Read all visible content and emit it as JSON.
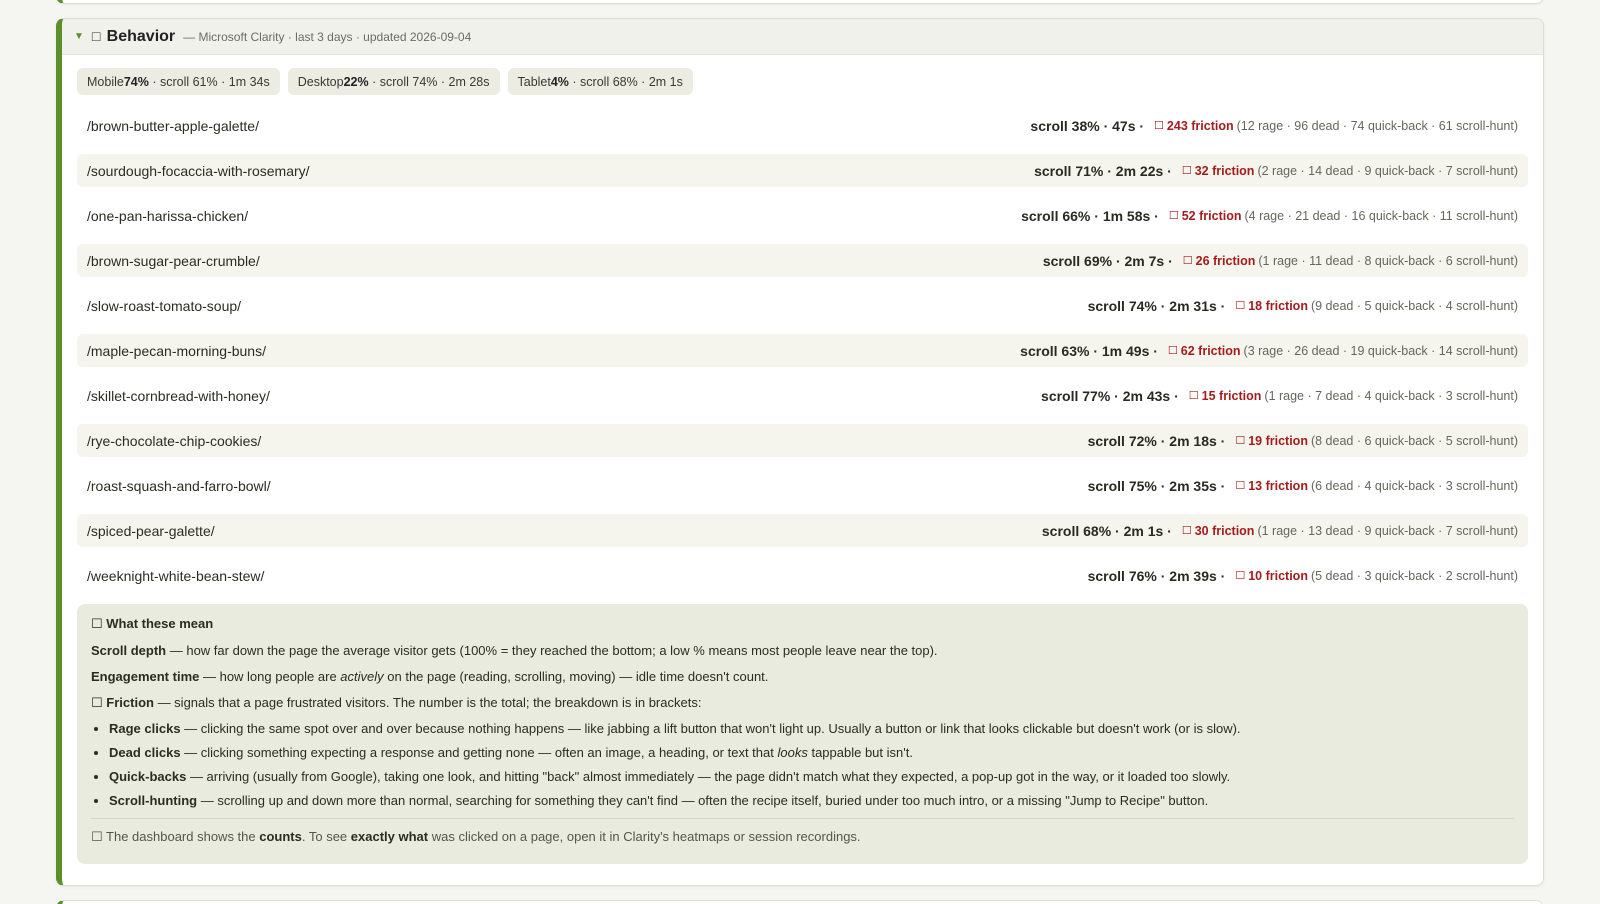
{
  "section": {
    "title": "Behavior",
    "subtitle": "— Microsoft Clarity · last 3 days · updated 2026-09-04",
    "caret_icon": "chevron-down-icon",
    "title_icon": "pointer-icon"
  },
  "devices": [
    {
      "name": "Mobile",
      "share": "74%",
      "details": " · scroll 61% · 1m 34s"
    },
    {
      "name": "Desktop",
      "share": "22%",
      "details": " · scroll 74% · 2m 28s"
    },
    {
      "name": "Tablet",
      "share": "4%",
      "details": " · scroll 68% · 2m 1s"
    }
  ],
  "pages": [
    {
      "path": "/brown-butter-apple-galette/",
      "summary": "scroll 38% · 47s ·",
      "friction": "243 friction",
      "breakdown": "(12 rage · 96 dead · 74 quick-back · 61 scroll-hunt)"
    },
    {
      "path": "/sourdough-focaccia-with-rosemary/",
      "summary": "scroll 71% · 2m 22s ·",
      "friction": "32 friction",
      "breakdown": "(2 rage · 14 dead · 9 quick-back · 7 scroll-hunt)"
    },
    {
      "path": "/one-pan-harissa-chicken/",
      "summary": "scroll 66% · 1m 58s ·",
      "friction": "52 friction",
      "breakdown": "(4 rage · 21 dead · 16 quick-back · 11 scroll-hunt)"
    },
    {
      "path": "/brown-sugar-pear-crumble/",
      "summary": "scroll 69% · 2m 7s ·",
      "friction": "26 friction",
      "breakdown": "(1 rage · 11 dead · 8 quick-back · 6 scroll-hunt)"
    },
    {
      "path": "/slow-roast-tomato-soup/",
      "summary": "scroll 74% · 2m 31s ·",
      "friction": "18 friction",
      "breakdown": "(9 dead · 5 quick-back · 4 scroll-hunt)"
    },
    {
      "path": "/maple-pecan-morning-buns/",
      "summary": "scroll 63% · 1m 49s ·",
      "friction": "62 friction",
      "breakdown": "(3 rage · 26 dead · 19 quick-back · 14 scroll-hunt)"
    },
    {
      "path": "/skillet-cornbread-with-honey/",
      "summary": "scroll 77% · 2m 43s ·",
      "friction": "15 friction",
      "breakdown": "(1 rage · 7 dead · 4 quick-back · 3 scroll-hunt)"
    },
    {
      "path": "/rye-chocolate-chip-cookies/",
      "summary": "scroll 72% · 2m 18s ·",
      "friction": "19 friction",
      "breakdown": "(8 dead · 6 quick-back · 5 scroll-hunt)"
    },
    {
      "path": "/roast-squash-and-farro-bowl/",
      "summary": "scroll 75% · 2m 35s ·",
      "friction": "13 friction",
      "breakdown": "(6 dead · 4 quick-back · 3 scroll-hunt)"
    },
    {
      "path": "/spiced-pear-galette/",
      "summary": "scroll 68% · 2m 1s ·",
      "friction": "30 friction",
      "breakdown": "(1 rage · 13 dead · 9 quick-back · 7 scroll-hunt)"
    },
    {
      "path": "/weeknight-white-bean-stew/",
      "summary": "scroll 76% · 2m 39s ·",
      "friction": "10 friction",
      "breakdown": "(5 dead · 3 quick-back · 2 scroll-hunt)"
    }
  ],
  "legend": {
    "title": "What these mean",
    "scroll_term": "Scroll depth",
    "scroll_desc": " — how far down the page the average visitor gets (100% = they reached the bottom; a low % means most people leave near the top).",
    "engagement_term": "Engagement time",
    "engagement_desc_a": " — how long people are ",
    "engagement_em": "actively",
    "engagement_desc_b": " on the page (reading, scrolling, moving) — idle time doesn't count.",
    "friction_term": "Friction",
    "friction_desc": " — signals that a page frustrated visitors. The number is the total; the breakdown is in brackets:",
    "rage_term": "Rage clicks",
    "rage_desc": " — clicking the same spot over and over because nothing happens — like jabbing a lift button that won't light up. Usually a button or link that looks clickable but doesn't work (or is slow).",
    "dead_term": "Dead clicks",
    "dead_desc_a": " — clicking something expecting a response and getting none — often an image, a heading, or text that ",
    "dead_em": "looks",
    "dead_desc_b": " tappable but isn't.",
    "quickback_term": "Quick-backs",
    "quickback_desc": " — arriving (usually from Google), taking one look, and hitting \"back\" almost immediately — the page didn't match what they expected, a pop-up got in the way, or it loaded too slowly.",
    "scrollhunt_term": "Scroll-hunting",
    "scrollhunt_desc": " — scrolling up and down more than normal, searching for something they can't find — often the recipe itself, buried under too much intro, or a missing \"Jump to Recipe\" button.",
    "note_a": "The dashboard shows the ",
    "note_b1": "counts",
    "note_c": ". To see ",
    "note_b2": "exactly what",
    "note_d": " was clicked on a page, open it in Clarity's heatmaps or session recordings."
  }
}
